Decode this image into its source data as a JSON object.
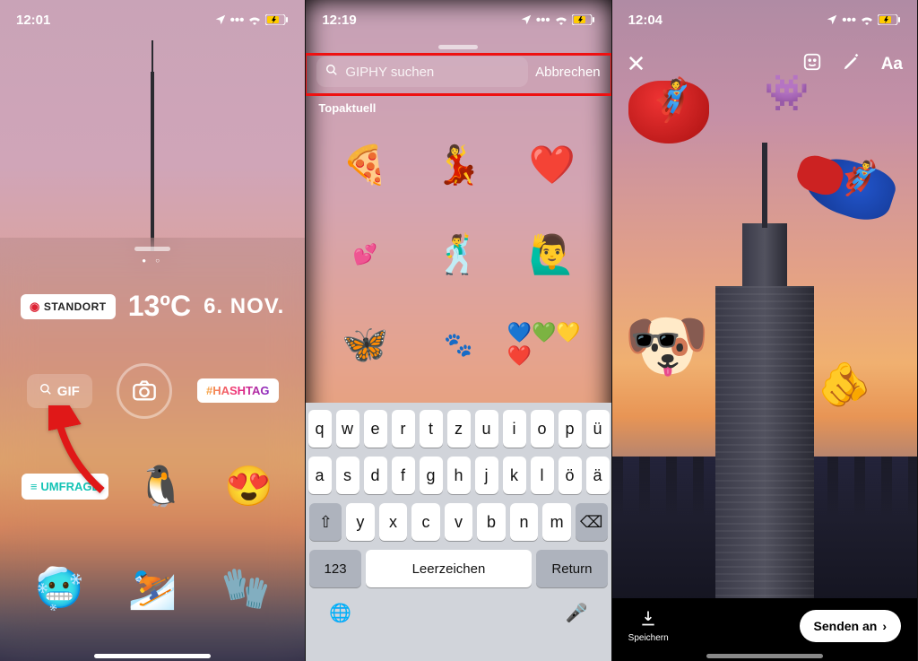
{
  "phone1": {
    "time": "12:01",
    "stickers": {
      "location_label": "STANDORT",
      "temperature": "13ºC",
      "date": "6. NOV.",
      "gif_label": "GIF",
      "hashtag_label": "#HASHTAG",
      "poll_label": "UMFRAGE"
    }
  },
  "phone2": {
    "time": "12:19",
    "search": {
      "placeholder": "GIPHY suchen"
    },
    "cancel": "Abbrechen",
    "trending": "Topaktuell",
    "keyboard": {
      "row1": [
        "q",
        "w",
        "e",
        "r",
        "t",
        "z",
        "u",
        "i",
        "o",
        "p",
        "ü"
      ],
      "row2": [
        "a",
        "s",
        "d",
        "f",
        "g",
        "h",
        "j",
        "k",
        "l",
        "ö",
        "ä"
      ],
      "row3": [
        "y",
        "x",
        "c",
        "v",
        "b",
        "n",
        "m"
      ],
      "num": "123",
      "space": "Leerzeichen",
      "return": "Return"
    }
  },
  "phone3": {
    "time": "12:04",
    "text_tool": "Aa",
    "save": "Speichern",
    "send": "Senden an"
  }
}
